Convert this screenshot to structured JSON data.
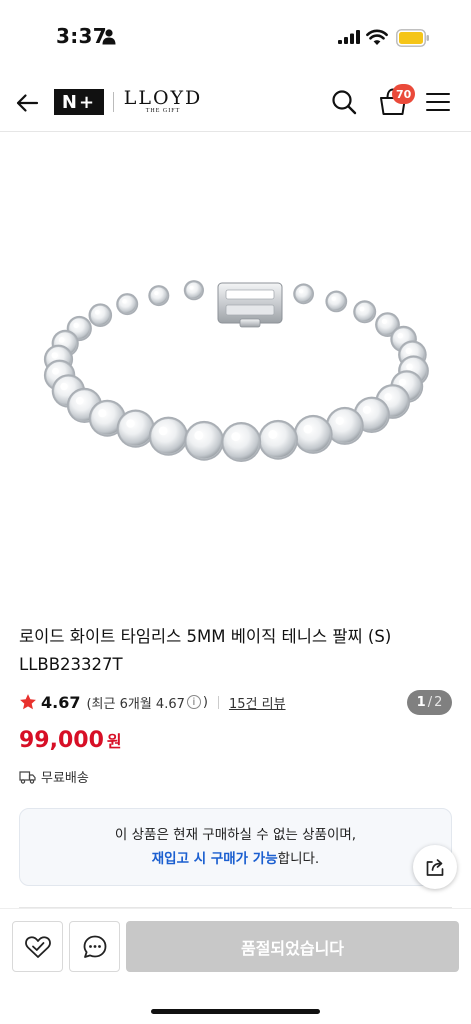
{
  "status_bar": {
    "time": "3:37"
  },
  "header": {
    "brand_badge": "N+",
    "brand_name": "LLOYD",
    "brand_sub": "THE GIFT",
    "cart_count": "70"
  },
  "gallery": {
    "current": "1",
    "separator": "/",
    "total": "2"
  },
  "product": {
    "title_line1": "로이드 화이트 타임리스 5MM 베이직 테니스 팔찌 (S)",
    "title_line2": "LLBB23327T",
    "rating": "4.67",
    "recent_rating_prefix": "(최근 6개월 4.67",
    "recent_rating_suffix": ")",
    "info_glyph": "i",
    "review_link": "15건 리뷰",
    "price": "99,000",
    "price_unit": "원",
    "shipping": "무료배송"
  },
  "notice": {
    "line1": "이 상품은 현재 구매하실 수 없는 상품이며,",
    "link": "재입고 시 구매가 가능",
    "line2_suffix": "합니다."
  },
  "bottom_bar": {
    "soldout_label": "품절되었습니다"
  },
  "colors": {
    "price_red": "#d70f26",
    "badge_red": "#ea4a3a",
    "link_blue": "#1b5fd0",
    "star_red": "#e8312d",
    "disabled_gray": "#c8c8c8"
  }
}
